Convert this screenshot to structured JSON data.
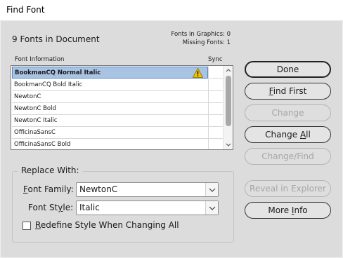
{
  "window": {
    "title": "Find Font"
  },
  "summary": {
    "count_label": "9 Fonts in Document",
    "fonts_in_graphics": "Fonts in Graphics: 0",
    "missing_fonts": "Missing Fonts: 1"
  },
  "list": {
    "col_info": "Font Information",
    "col_sync": "Sync",
    "rows": [
      {
        "name": "BookmanCQ Normal Italic",
        "warning": true,
        "selected": true
      },
      {
        "name": "BookmanCQ Bold Italic"
      },
      {
        "name": "NewtonC"
      },
      {
        "name": "NewtonC Bold"
      },
      {
        "name": "NewtonC Italic"
      },
      {
        "name": "OfficinaSansC"
      },
      {
        "name": "OfficinaSansC Bold"
      }
    ]
  },
  "replace": {
    "group_label": "Replace With:",
    "family": {
      "label_u": "F",
      "label_rest": "ont Family:",
      "value": "NewtonC"
    },
    "style": {
      "label_pre": "Font St",
      "label_u": "y",
      "label_rest": "le:",
      "value": "Italic"
    },
    "redefine": {
      "label_u": "R",
      "label_rest": "edefine Style When Changing All",
      "checked": false
    }
  },
  "buttons": {
    "done": {
      "label": "Done"
    },
    "find_first": {
      "u": "F",
      "rest": "ind First"
    },
    "change": {
      "label": "Change"
    },
    "change_all": {
      "pre": "Change ",
      "u": "A",
      "rest": "ll"
    },
    "change_find": {
      "label": "Change/Find"
    },
    "reveal": {
      "label": "Reveal in Explorer"
    },
    "more_info": {
      "pre": "More ",
      "u": "I",
      "rest": "nfo"
    }
  },
  "colors": {
    "selection": "#a9c3e3",
    "warning": "#f2c200"
  }
}
